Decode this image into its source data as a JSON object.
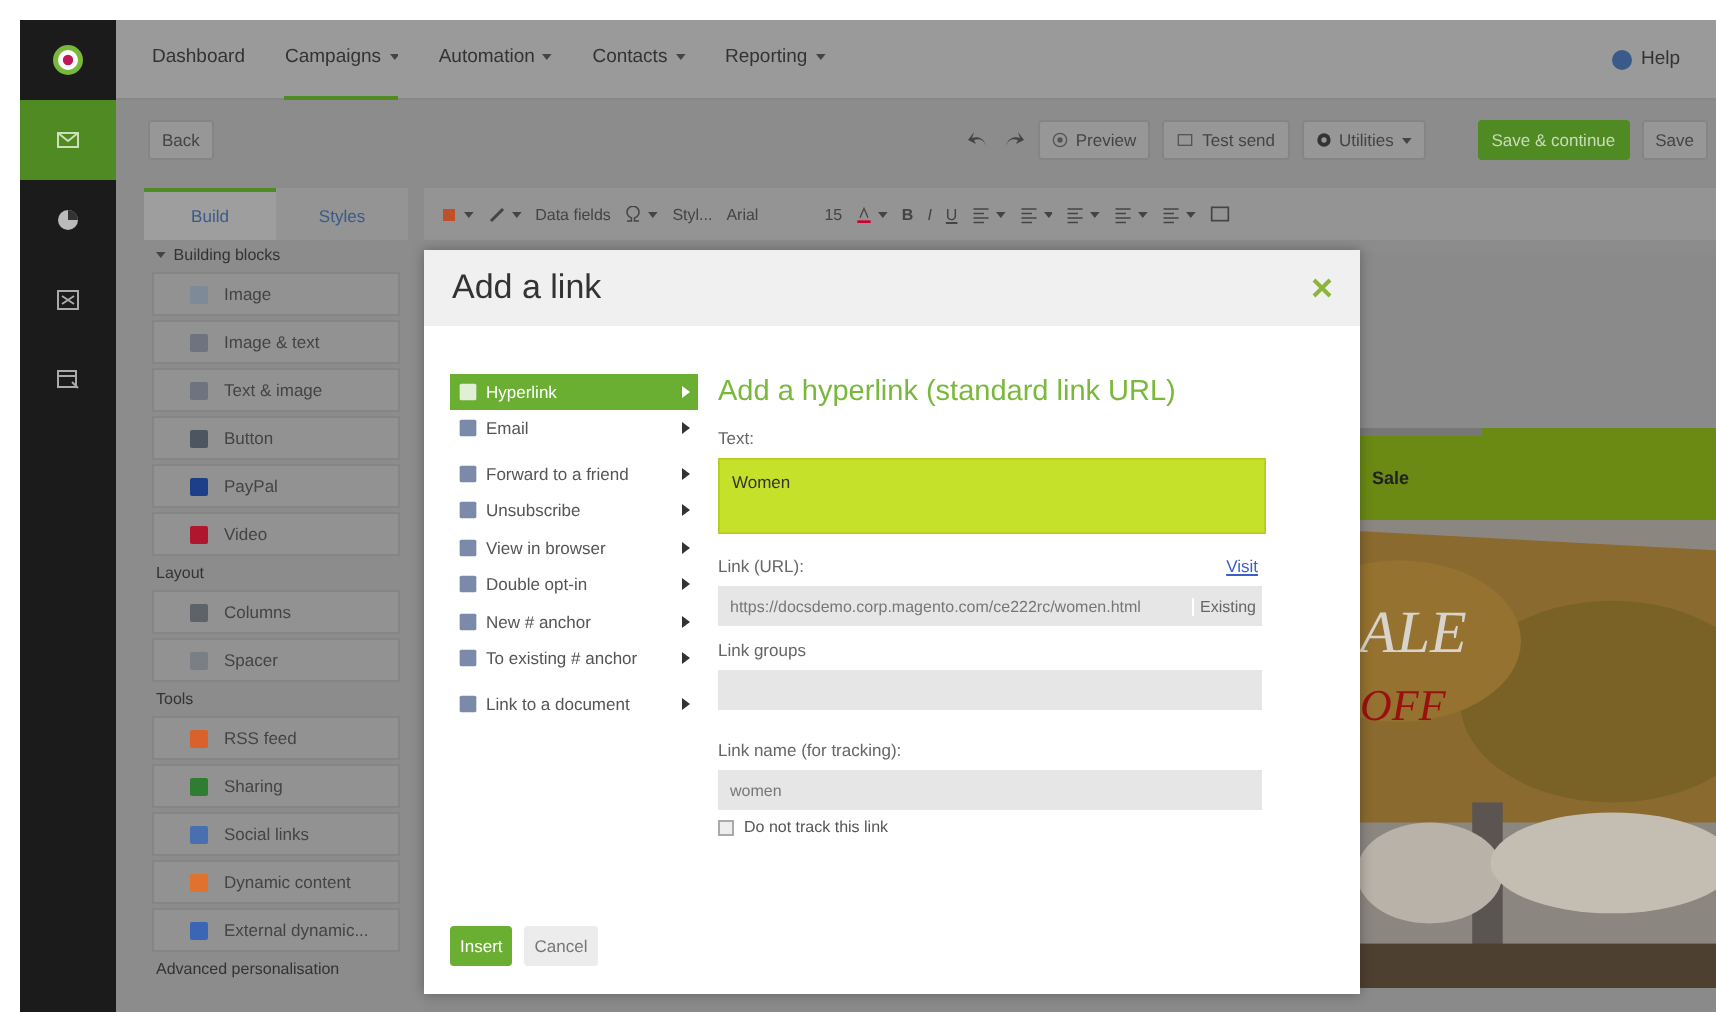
{
  "nav": {
    "items": [
      {
        "label": "Dashboard",
        "selected": false,
        "dropdown": false
      },
      {
        "label": "Campaigns",
        "selected": true,
        "dropdown": true
      },
      {
        "label": "Automation",
        "selected": false,
        "dropdown": true
      },
      {
        "label": "Contacts",
        "selected": false,
        "dropdown": true
      },
      {
        "label": "Reporting",
        "selected": false,
        "dropdown": true
      }
    ],
    "help": "Help"
  },
  "action_bar": {
    "back": "Back",
    "preview": "Preview",
    "test_send": "Test send",
    "utilities": "Utilities",
    "save_continue": "Save & continue",
    "save": "Save"
  },
  "editor_toolbar": {
    "data_fields": "Data fields",
    "style": "Styl...",
    "font": "Arial",
    "size": "15",
    "bold": "B",
    "italic": "I",
    "underline": "U"
  },
  "panel": {
    "tabs": [
      {
        "label": "Build",
        "selected": true
      },
      {
        "label": "Styles",
        "selected": false
      }
    ],
    "sections": [
      {
        "title": "Building blocks",
        "kind": "toggle",
        "blocks": [
          {
            "label": "Image",
            "color": "#7f8a99"
          },
          {
            "label": "Image & text",
            "color": "#6d7480"
          },
          {
            "label": "Text & image",
            "color": "#6d7480"
          },
          {
            "label": "Button",
            "color": "#4d5560"
          },
          {
            "label": "PayPal",
            "color": "#1d3f8a"
          },
          {
            "label": "Video",
            "color": "#b0172e"
          }
        ]
      },
      {
        "title": "Layout",
        "kind": "label",
        "blocks": [
          {
            "label": "Columns",
            "color": "#5e636a"
          },
          {
            "label": "Spacer",
            "color": "#7a7f86"
          }
        ]
      },
      {
        "title": "Tools",
        "kind": "label",
        "blocks": [
          {
            "label": "RSS feed",
            "color": "#d9622b"
          },
          {
            "label": "Sharing",
            "color": "#2f7d32"
          },
          {
            "label": "Social links",
            "color": "#4a6fb0"
          },
          {
            "label": "Dynamic content",
            "color": "#e0722e"
          },
          {
            "label": "External dynamic...",
            "color": "#3a66b5"
          }
        ]
      },
      {
        "title": "Advanced personalisation",
        "kind": "label"
      }
    ]
  },
  "canvas": {
    "menu_cell": "Sale",
    "headline": "ALE",
    "subline": "OFF"
  },
  "dialog": {
    "title": "Add a link",
    "menu": [
      {
        "label": "Hyperlink",
        "selected": true
      },
      {
        "label": "Email",
        "selected": false
      },
      {
        "label": "Forward to a friend",
        "selected": false
      },
      {
        "label": "Unsubscribe",
        "selected": false
      },
      {
        "label": "View in browser",
        "selected": false
      },
      {
        "label": "Double opt-in",
        "selected": false
      },
      {
        "label": "New # anchor",
        "selected": false
      },
      {
        "label": "To existing # anchor",
        "selected": false
      },
      {
        "label": "Link to a document",
        "selected": false
      }
    ],
    "heading": "Add a hyperlink (standard link URL)",
    "text_label": "Text:",
    "text_value": "Women",
    "url_label": "Link (URL):",
    "visit": "Visit",
    "url_value": "https://docsdemo.corp.magento.com/ce222rc/women.html",
    "existing": "Existing",
    "groups_label": "Link groups",
    "name_label": "Link name (for tracking):",
    "name_value": "women",
    "no_track": {
      "label": "Do not track this link",
      "checked": false
    },
    "insert": "Insert",
    "cancel": "Cancel"
  }
}
